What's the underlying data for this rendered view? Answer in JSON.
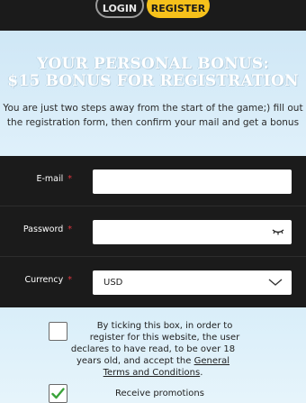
{
  "header": {
    "login_label": "LOGIN",
    "register_label": "REGISTER"
  },
  "hero": {
    "title_line1": "YOUR PERSONAL BONUS:",
    "title_line2": "$15 BONUS FOR REGISTRATION",
    "description": "You are just two steps away from the start of the game;) fill out the registration form, then confirm your mail and get a bonus"
  },
  "form": {
    "email_label": "E-mail",
    "password_label": "Password",
    "currency_label": "Currency",
    "required_mark": "*",
    "email_value": "",
    "password_value": "",
    "currency_value": "USD"
  },
  "consent": {
    "terms_line1": "By ticking this box, in order to",
    "terms_line2": "register for this website, the user",
    "terms_line3": "declares to have read, to be over 18",
    "terms_line4_prefix": "years old, and accept the ",
    "terms_link_1": "General",
    "terms_link_2": "Terms and Conditions",
    "terms_suffix": ".",
    "terms_checked": false,
    "promo_label": "Receive promotions",
    "promo_checked": true
  },
  "colors": {
    "accent": "#f6c11b",
    "required": "#e0363f",
    "dark_bg": "#1b1b1b",
    "check": "#3aa33a"
  },
  "icons": [
    "eye-closed-icon",
    "chevron-down-icon",
    "checkmark-icon"
  ]
}
